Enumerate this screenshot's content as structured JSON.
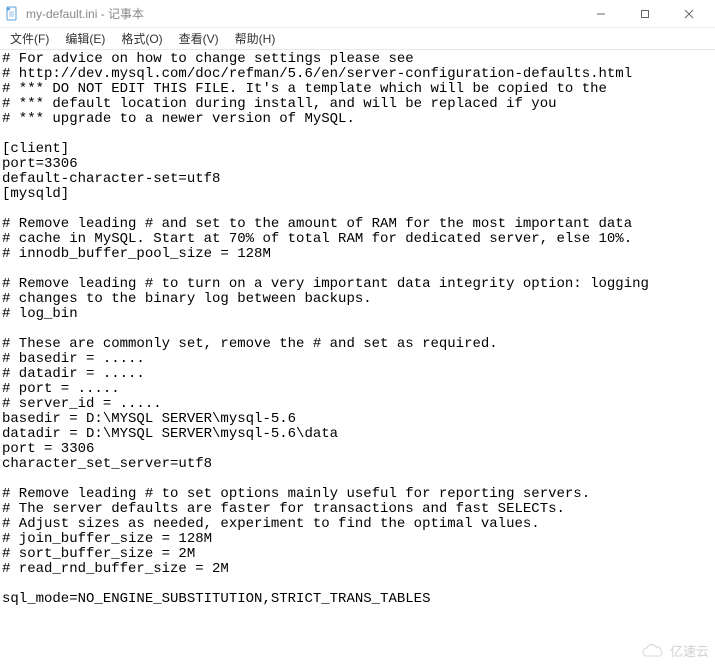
{
  "window": {
    "title": "my-default.ini - 记事本",
    "icon_name": "notepad-file-icon"
  },
  "menubar": {
    "file": "文件(F)",
    "edit": "编辑(E)",
    "format": "格式(O)",
    "view": "查看(V)",
    "help": "帮助(H)"
  },
  "editor": {
    "content": "# For advice on how to change settings please see\n# http://dev.mysql.com/doc/refman/5.6/en/server-configuration-defaults.html\n# *** DO NOT EDIT THIS FILE. It's a template which will be copied to the\n# *** default location during install, and will be replaced if you\n# *** upgrade to a newer version of MySQL.\n\n[client]\nport=3306\ndefault-character-set=utf8\n[mysqld]\n\n# Remove leading # and set to the amount of RAM for the most important data\n# cache in MySQL. Start at 70% of total RAM for dedicated server, else 10%.\n# innodb_buffer_pool_size = 128M\n\n# Remove leading # to turn on a very important data integrity option: logging\n# changes to the binary log between backups.\n# log_bin\n\n# These are commonly set, remove the # and set as required.\n# basedir = .....\n# datadir = .....\n# port = .....\n# server_id = .....\nbasedir = D:\\MYSQL SERVER\\mysql-5.6\ndatadir = D:\\MYSQL SERVER\\mysql-5.6\\data\nport = 3306\ncharacter_set_server=utf8\n\n# Remove leading # to set options mainly useful for reporting servers.\n# The server defaults are faster for transactions and fast SELECTs.\n# Adjust sizes as needed, experiment to find the optimal values.\n# join_buffer_size = 128M\n# sort_buffer_size = 2M\n# read_rnd_buffer_size = 2M\n\nsql_mode=NO_ENGINE_SUBSTITUTION,STRICT_TRANS_TABLES"
  },
  "watermark": {
    "text": "亿速云"
  }
}
